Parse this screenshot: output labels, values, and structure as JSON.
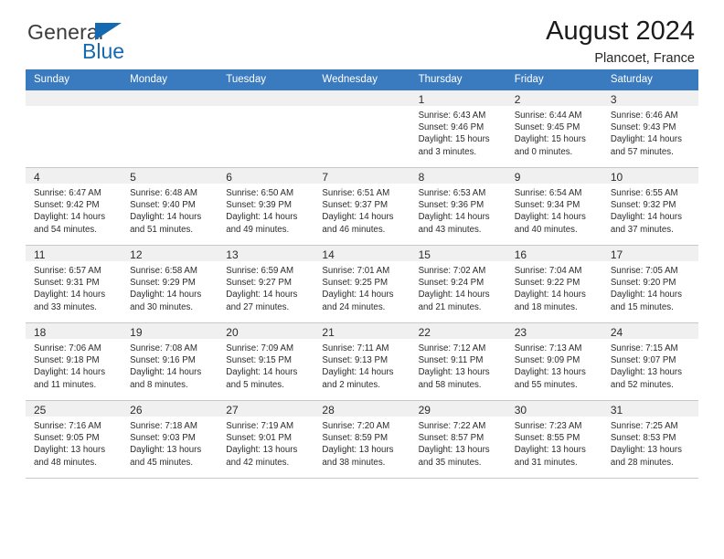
{
  "brand": {
    "name_top": "General",
    "name_bottom": "Blue",
    "triangle_icon": "triangle-icon",
    "colors": {
      "blue": "#1569b0",
      "dark": "#3b3b3b"
    }
  },
  "header": {
    "title": "August 2024",
    "subtitle": "Plancoet, France"
  },
  "calendar": {
    "header_bg": "#3a7bbf",
    "daynum_band_bg": "#f0f0f0",
    "weekdays": [
      "Sunday",
      "Monday",
      "Tuesday",
      "Wednesday",
      "Thursday",
      "Friday",
      "Saturday"
    ],
    "weeks": [
      [
        {
          "day": "",
          "lines": []
        },
        {
          "day": "",
          "lines": []
        },
        {
          "day": "",
          "lines": []
        },
        {
          "day": "",
          "lines": []
        },
        {
          "day": "1",
          "lines": [
            "Sunrise: 6:43 AM",
            "Sunset: 9:46 PM",
            "Daylight: 15 hours",
            "and 3 minutes."
          ]
        },
        {
          "day": "2",
          "lines": [
            "Sunrise: 6:44 AM",
            "Sunset: 9:45 PM",
            "Daylight: 15 hours",
            "and 0 minutes."
          ]
        },
        {
          "day": "3",
          "lines": [
            "Sunrise: 6:46 AM",
            "Sunset: 9:43 PM",
            "Daylight: 14 hours",
            "and 57 minutes."
          ]
        }
      ],
      [
        {
          "day": "4",
          "lines": [
            "Sunrise: 6:47 AM",
            "Sunset: 9:42 PM",
            "Daylight: 14 hours",
            "and 54 minutes."
          ]
        },
        {
          "day": "5",
          "lines": [
            "Sunrise: 6:48 AM",
            "Sunset: 9:40 PM",
            "Daylight: 14 hours",
            "and 51 minutes."
          ]
        },
        {
          "day": "6",
          "lines": [
            "Sunrise: 6:50 AM",
            "Sunset: 9:39 PM",
            "Daylight: 14 hours",
            "and 49 minutes."
          ]
        },
        {
          "day": "7",
          "lines": [
            "Sunrise: 6:51 AM",
            "Sunset: 9:37 PM",
            "Daylight: 14 hours",
            "and 46 minutes."
          ]
        },
        {
          "day": "8",
          "lines": [
            "Sunrise: 6:53 AM",
            "Sunset: 9:36 PM",
            "Daylight: 14 hours",
            "and 43 minutes."
          ]
        },
        {
          "day": "9",
          "lines": [
            "Sunrise: 6:54 AM",
            "Sunset: 9:34 PM",
            "Daylight: 14 hours",
            "and 40 minutes."
          ]
        },
        {
          "day": "10",
          "lines": [
            "Sunrise: 6:55 AM",
            "Sunset: 9:32 PM",
            "Daylight: 14 hours",
            "and 37 minutes."
          ]
        }
      ],
      [
        {
          "day": "11",
          "lines": [
            "Sunrise: 6:57 AM",
            "Sunset: 9:31 PM",
            "Daylight: 14 hours",
            "and 33 minutes."
          ]
        },
        {
          "day": "12",
          "lines": [
            "Sunrise: 6:58 AM",
            "Sunset: 9:29 PM",
            "Daylight: 14 hours",
            "and 30 minutes."
          ]
        },
        {
          "day": "13",
          "lines": [
            "Sunrise: 6:59 AM",
            "Sunset: 9:27 PM",
            "Daylight: 14 hours",
            "and 27 minutes."
          ]
        },
        {
          "day": "14",
          "lines": [
            "Sunrise: 7:01 AM",
            "Sunset: 9:25 PM",
            "Daylight: 14 hours",
            "and 24 minutes."
          ]
        },
        {
          "day": "15",
          "lines": [
            "Sunrise: 7:02 AM",
            "Sunset: 9:24 PM",
            "Daylight: 14 hours",
            "and 21 minutes."
          ]
        },
        {
          "day": "16",
          "lines": [
            "Sunrise: 7:04 AM",
            "Sunset: 9:22 PM",
            "Daylight: 14 hours",
            "and 18 minutes."
          ]
        },
        {
          "day": "17",
          "lines": [
            "Sunrise: 7:05 AM",
            "Sunset: 9:20 PM",
            "Daylight: 14 hours",
            "and 15 minutes."
          ]
        }
      ],
      [
        {
          "day": "18",
          "lines": [
            "Sunrise: 7:06 AM",
            "Sunset: 9:18 PM",
            "Daylight: 14 hours",
            "and 11 minutes."
          ]
        },
        {
          "day": "19",
          "lines": [
            "Sunrise: 7:08 AM",
            "Sunset: 9:16 PM",
            "Daylight: 14 hours",
            "and 8 minutes."
          ]
        },
        {
          "day": "20",
          "lines": [
            "Sunrise: 7:09 AM",
            "Sunset: 9:15 PM",
            "Daylight: 14 hours",
            "and 5 minutes."
          ]
        },
        {
          "day": "21",
          "lines": [
            "Sunrise: 7:11 AM",
            "Sunset: 9:13 PM",
            "Daylight: 14 hours",
            "and 2 minutes."
          ]
        },
        {
          "day": "22",
          "lines": [
            "Sunrise: 7:12 AM",
            "Sunset: 9:11 PM",
            "Daylight: 13 hours",
            "and 58 minutes."
          ]
        },
        {
          "day": "23",
          "lines": [
            "Sunrise: 7:13 AM",
            "Sunset: 9:09 PM",
            "Daylight: 13 hours",
            "and 55 minutes."
          ]
        },
        {
          "day": "24",
          "lines": [
            "Sunrise: 7:15 AM",
            "Sunset: 9:07 PM",
            "Daylight: 13 hours",
            "and 52 minutes."
          ]
        }
      ],
      [
        {
          "day": "25",
          "lines": [
            "Sunrise: 7:16 AM",
            "Sunset: 9:05 PM",
            "Daylight: 13 hours",
            "and 48 minutes."
          ]
        },
        {
          "day": "26",
          "lines": [
            "Sunrise: 7:18 AM",
            "Sunset: 9:03 PM",
            "Daylight: 13 hours",
            "and 45 minutes."
          ]
        },
        {
          "day": "27",
          "lines": [
            "Sunrise: 7:19 AM",
            "Sunset: 9:01 PM",
            "Daylight: 13 hours",
            "and 42 minutes."
          ]
        },
        {
          "day": "28",
          "lines": [
            "Sunrise: 7:20 AM",
            "Sunset: 8:59 PM",
            "Daylight: 13 hours",
            "and 38 minutes."
          ]
        },
        {
          "day": "29",
          "lines": [
            "Sunrise: 7:22 AM",
            "Sunset: 8:57 PM",
            "Daylight: 13 hours",
            "and 35 minutes."
          ]
        },
        {
          "day": "30",
          "lines": [
            "Sunrise: 7:23 AM",
            "Sunset: 8:55 PM",
            "Daylight: 13 hours",
            "and 31 minutes."
          ]
        },
        {
          "day": "31",
          "lines": [
            "Sunrise: 7:25 AM",
            "Sunset: 8:53 PM",
            "Daylight: 13 hours",
            "and 28 minutes."
          ]
        }
      ]
    ]
  }
}
